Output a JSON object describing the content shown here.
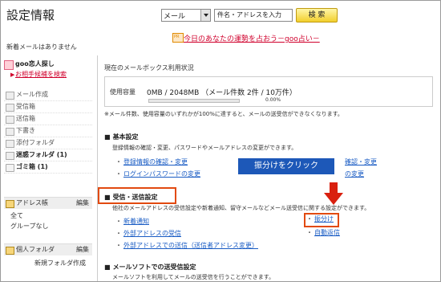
{
  "header": {
    "title": "設定情報",
    "search_type": "メール",
    "search_placeholder": "件名・アドレスを入力",
    "search_button": "検 索"
  },
  "notice": {
    "new_mail": "新着メールはありません",
    "fortune_link": "今日のあなたの運勢を占おう－goo占い－"
  },
  "sidebar": {
    "goo_title": "goo恋人探し",
    "goo_link": "お相手候補を検索",
    "items": [
      {
        "label": "メール作成",
        "bold": false
      },
      {
        "label": "受信箱",
        "bold": false
      },
      {
        "label": "送信箱",
        "bold": false
      },
      {
        "label": "下書き",
        "bold": false
      },
      {
        "label": "添付フォルダ",
        "bold": false
      },
      {
        "label": "迷惑フォルダ (1)",
        "bold": true
      },
      {
        "label": "ゴミ箱 (1)",
        "bold": true
      }
    ],
    "address_book": {
      "title": "アドレス帳",
      "edit": "編集",
      "lines": [
        "全て",
        "グループなし"
      ]
    },
    "personal_folder": {
      "title": "個人フォルダ",
      "edit": "編集",
      "lines": [
        "新規フォルダ作成"
      ]
    }
  },
  "main": {
    "status_title": "現在のメールボックス利用状況",
    "capacity_label": "使用容量",
    "capacity_value": "0MB / 2048MB （メール件数 2件 / 10万件）",
    "usage_percent_text": "0.00%",
    "usage_fraction": 0.0,
    "note": "※メール件数、使用容量のいずれかが100%に達すると、メールの送受信ができなくなります。",
    "basic": {
      "heading": "基本設定",
      "desc": "登録情報の確認・変更、パスワードやメールアドレスの変更ができます。",
      "links": [
        "登録情報の確認・変更",
        "ログインパスワードの変更",
        "確認・変更",
        "の変更"
      ]
    },
    "send_receive": {
      "heading": "受信・送信設定",
      "desc": "他社のメールアドレスの受信設定や新着通知、留守メールなどメール送受信に関する設定ができます。",
      "links_left": [
        "新着通知",
        "外部アドレスの受信",
        "外部アドレスでの送信（送信者アドレス変更）"
      ],
      "links_right": [
        "振分け",
        "自動返信"
      ]
    },
    "mail_soft": {
      "heading": "メールソフトでの送受信設定",
      "desc": "メールソフトを利用してメールの送受信を行うことができます。"
    },
    "callout": "振分けをクリック",
    "colors": {
      "callout_bg": "#1d58b8",
      "highlight": "#e24a10",
      "link": "#1a5cc4",
      "alert": "#d0002c"
    }
  }
}
